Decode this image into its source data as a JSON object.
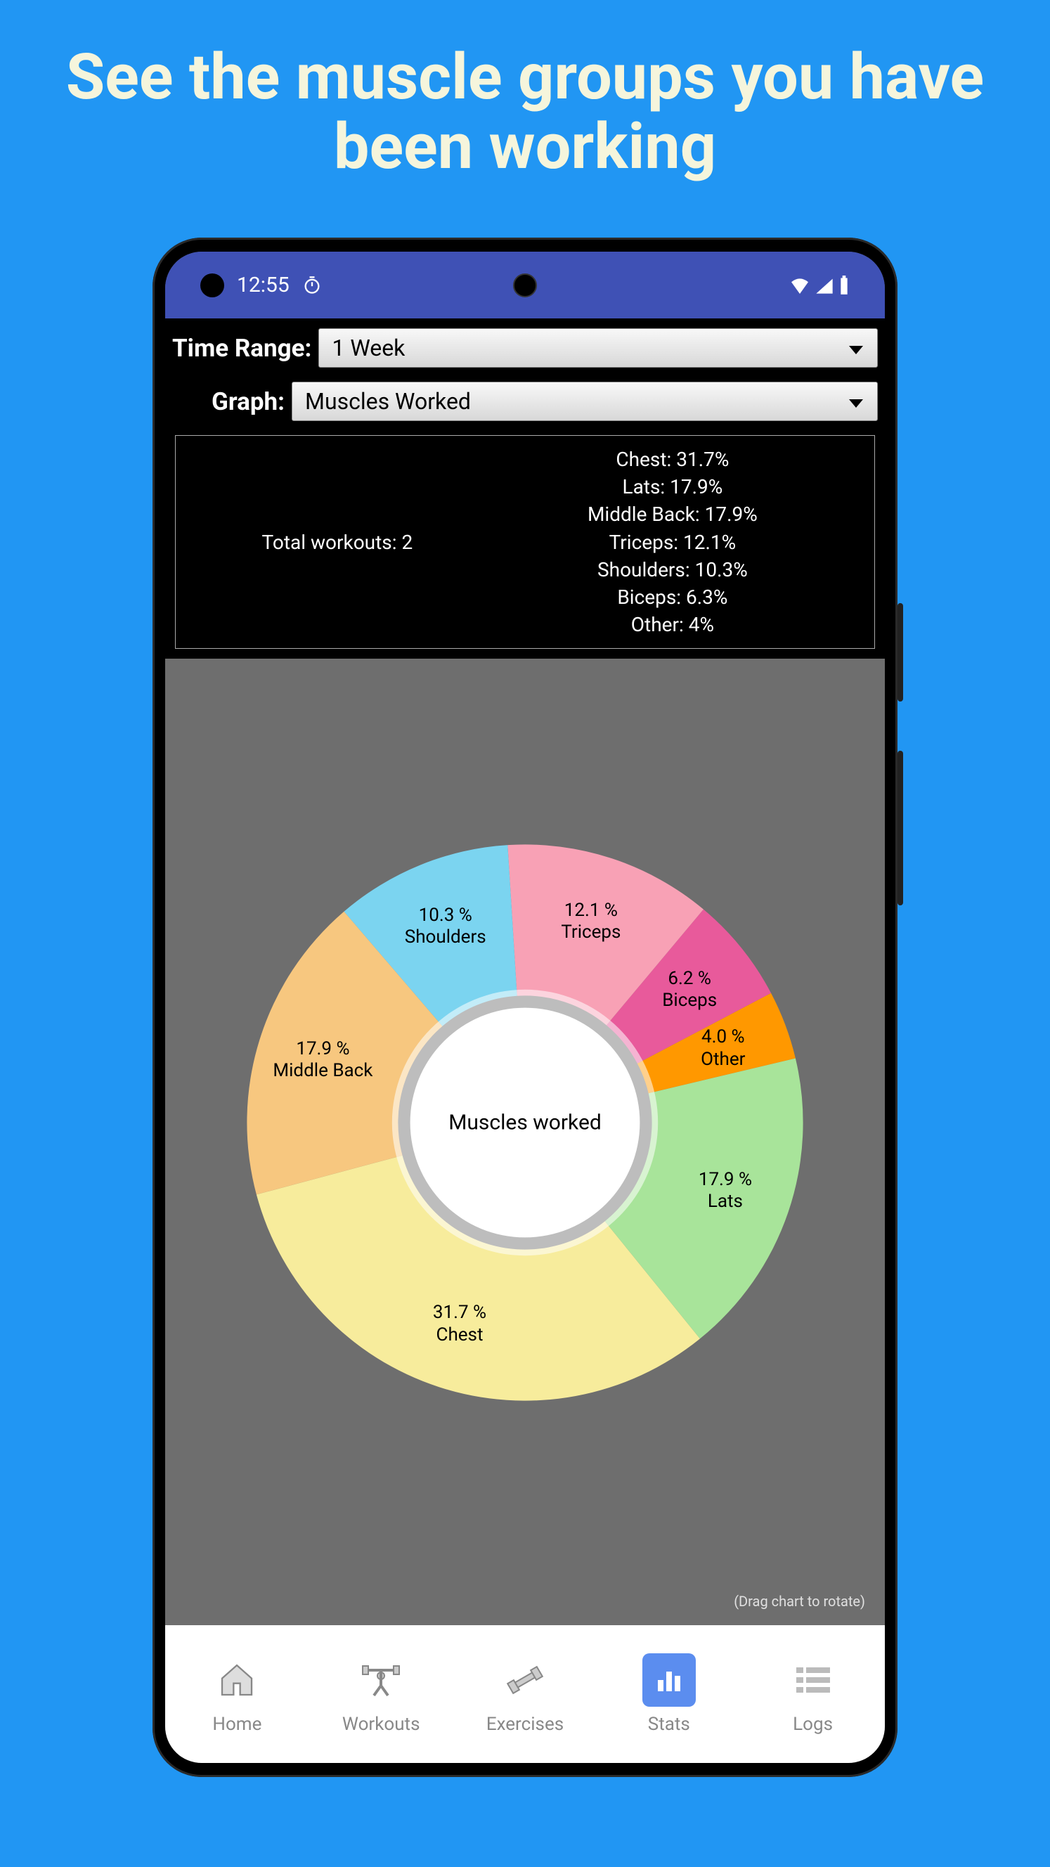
{
  "hero": {
    "title": "See the muscle groups you have been working"
  },
  "status_bar": {
    "time": "12:55"
  },
  "controls": {
    "time_range_label": "Time Range:",
    "time_range_value": "1 Week",
    "graph_label": "Graph:",
    "graph_value": "Muscles Worked"
  },
  "summary": {
    "total_workouts_label": "Total workouts: 2",
    "lines": [
      "Chest: 31.7%",
      "Lats: 17.9%",
      "Middle Back: 17.9%",
      "Triceps: 12.1%",
      "Shoulders: 10.3%",
      "Biceps: 6.3%",
      "Other: 4%"
    ]
  },
  "chart_data": {
    "type": "pie",
    "title": "Muscles worked",
    "series": [
      {
        "name": "Chest",
        "value": 31.7,
        "label": "31.7 %\nChest",
        "color": "#f7ec9c"
      },
      {
        "name": "Lats",
        "value": 17.9,
        "label": "17.9 %\nLats",
        "color": "#a8e49a"
      },
      {
        "name": "Other",
        "value": 4.0,
        "label": "4.0 %\nOther",
        "color": "#ff9800"
      },
      {
        "name": "Biceps",
        "value": 6.2,
        "label": "6.2 %\nBiceps",
        "color": "#e85a9b"
      },
      {
        "name": "Triceps",
        "value": 12.1,
        "label": "12.1 %\nTriceps",
        "color": "#f8a1b5"
      },
      {
        "name": "Shoulders",
        "value": 10.3,
        "label": "10.3 %\nShoulders",
        "color": "#7bd4f0"
      },
      {
        "name": "Middle Back",
        "value": 17.9,
        "label": "17.9 %\nMiddle Back",
        "color": "#f7c77f"
      }
    ]
  },
  "chart_hint": "(Drag chart to rotate)",
  "nav": {
    "items": [
      {
        "label": "Home"
      },
      {
        "label": "Workouts"
      },
      {
        "label": "Exercises"
      },
      {
        "label": "Stats"
      },
      {
        "label": "Logs"
      }
    ]
  }
}
